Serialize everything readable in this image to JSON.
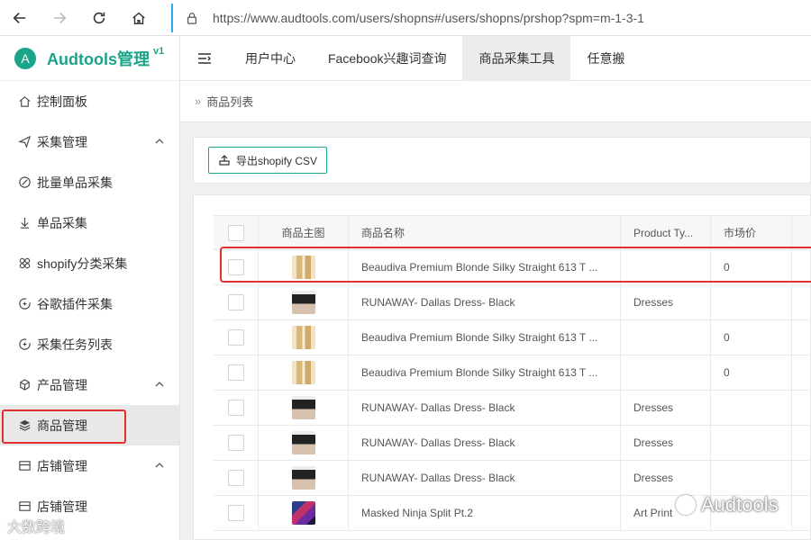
{
  "browser": {
    "url": "https://www.audtools.com/users/shopns#/users/shopns/prshop?spm=m-1-3-1"
  },
  "brand": {
    "logo_letter": "A",
    "name": "Audtools管理",
    "version": "v1"
  },
  "sidebar": {
    "items": [
      {
        "label": "控制面板",
        "icon": "home-icon"
      },
      {
        "label": "采集管理",
        "icon": "send-icon",
        "expandable": true
      },
      {
        "label": "批量单品采集",
        "icon": "link-icon"
      },
      {
        "label": "单品采集",
        "icon": "download-arrow-icon"
      },
      {
        "label": "shopify分类采集",
        "icon": "grid-icon"
      },
      {
        "label": "谷歌插件采集",
        "icon": "circle-plus-icon"
      },
      {
        "label": "采集任务列表",
        "icon": "circle-plus-icon"
      },
      {
        "label": "产品管理",
        "icon": "box-icon",
        "expandable": true
      },
      {
        "label": "商品管理",
        "icon": "layers-icon",
        "active": true
      },
      {
        "label": "店铺管理",
        "icon": "store-icon",
        "expandable": true
      },
      {
        "label": "店铺管理",
        "icon": "store-icon"
      }
    ]
  },
  "tabs": [
    {
      "label": "用户中心"
    },
    {
      "label": "Facebook兴趣词查询"
    },
    {
      "label": "商品采集工具",
      "active": true
    },
    {
      "label": "任意搬"
    }
  ],
  "breadcrumb": {
    "current": "商品列表"
  },
  "toolbar": {
    "export_label": "导出shopify CSV"
  },
  "table": {
    "headers": {
      "image": "商品主图",
      "name": "商品名称",
      "type": "Product Ty...",
      "price": "市场价"
    },
    "rows": [
      {
        "thumb": "blonde",
        "name": "Beaudiva Premium Blonde Silky Straight 613 T ...",
        "type": "",
        "price": "0"
      },
      {
        "thumb": "dress",
        "name": "RUNAWAY- Dallas Dress- Black",
        "type": "Dresses",
        "price": ""
      },
      {
        "thumb": "blonde",
        "name": "Beaudiva Premium Blonde Silky Straight 613 T ...",
        "type": "",
        "price": "0"
      },
      {
        "thumb": "blonde",
        "name": "Beaudiva Premium Blonde Silky Straight 613 T ...",
        "type": "",
        "price": "0"
      },
      {
        "thumb": "dress",
        "name": "RUNAWAY- Dallas Dress- Black",
        "type": "Dresses",
        "price": ""
      },
      {
        "thumb": "dress",
        "name": "RUNAWAY- Dallas Dress- Black",
        "type": "Dresses",
        "price": ""
      },
      {
        "thumb": "dress",
        "name": "RUNAWAY- Dallas Dress- Black",
        "type": "Dresses",
        "price": ""
      },
      {
        "thumb": "ninja",
        "name": "Masked Ninja Split Pt.2",
        "type": "Art Print",
        "price": ""
      }
    ]
  },
  "watermarks": {
    "left": "大数跨境",
    "right": "Audtools"
  },
  "colors": {
    "brand": "#1aa58a",
    "highlight": "#e03030",
    "url_accent": "#2aa8f0"
  }
}
